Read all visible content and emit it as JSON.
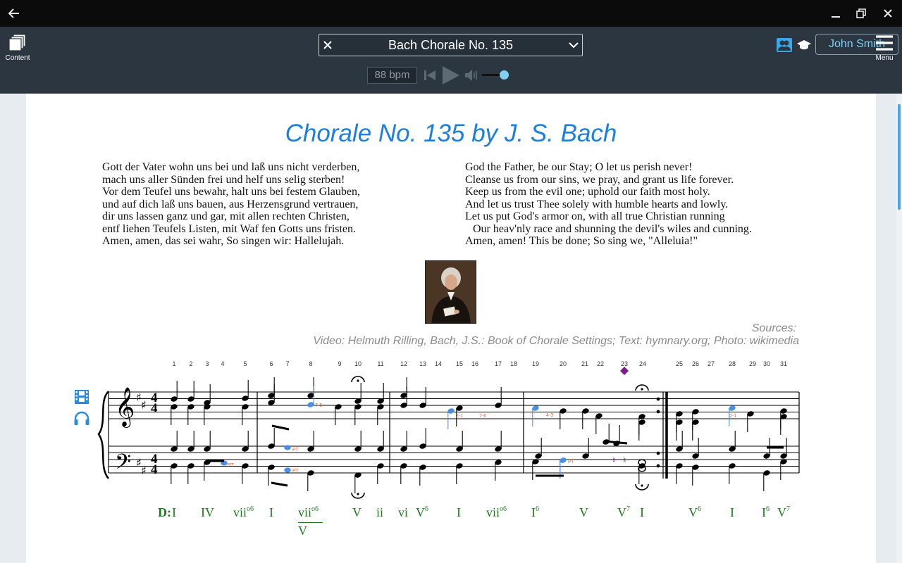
{
  "window": {
    "back_label": "←"
  },
  "toolbar": {
    "content_label": "Content",
    "menu_label": "Menu",
    "piece_selector": "Bach Chorale No. 135",
    "tempo": "88 bpm",
    "user_name": "John Smith"
  },
  "document": {
    "title": "Chorale No. 135 by J. S. Bach",
    "lyrics_german": [
      "Gott der Vater wohn uns bei und laß uns nicht verderben,",
      "mach uns aller Sünden frei und helf uns selig sterben!",
      "Vor dem Teufel uns bewahr, halt uns bei festem Glauben,",
      "und auf dich laß uns bauen, aus Herzensgrund vertrauen,",
      "dir uns lassen ganz und gar, mit allen rechten Christen,",
      "entf liehen Teufels Listen, mit Waf fen Gotts uns fristen.",
      "Amen, amen, das sei wahr, So singen wir: Hallelujah."
    ],
    "lyrics_english": [
      "God the Father, be our Stay; O let us perish never!",
      "Cleanse us from our sins, we pray, and grant us life forever.",
      "Keep us from the evil one; uphold our faith most holy.",
      "And let us trust Thee solely with humble hearts and lowly.",
      "Let us put God's armor on, with all true Christian running",
      "Our heav'nly race and shunning the devil's wiles and cunning.",
      "Amen, amen! This be done; So sing we, \"Alleluia!\""
    ],
    "sources_label": "Sources:",
    "sources_text": "Video: Helmuth Rilling, Bach, J.S.: Book of Chorale Settings; Text: hymnary.org; Photo: wikimedia"
  },
  "score": {
    "key_label": "D:",
    "beat_numbers": [
      "1",
      "2",
      "3",
      "4",
      "5",
      "6",
      "7",
      "8",
      "9",
      "10",
      "11",
      "12",
      "13",
      "14",
      "15",
      "16",
      "17",
      "18",
      "19",
      "20",
      "21",
      "22",
      "23",
      "24",
      "25",
      "26",
      "27",
      "28",
      "29",
      "30",
      "31"
    ],
    "roman_numerals": [
      {
        "base": "I",
        "sup": ""
      },
      {
        "base": "IV",
        "sup": ""
      },
      {
        "base": "vii",
        "sup": "o6"
      },
      {
        "base": "I",
        "sup": ""
      },
      {
        "base": "vii",
        "sup": "o6"
      },
      {
        "base": "V",
        "sup": ""
      },
      {
        "base": "ii",
        "sup": ""
      },
      {
        "base": "vi",
        "sup": ""
      },
      {
        "base": "V",
        "sup": "6"
      },
      {
        "base": "I",
        "sup": ""
      },
      {
        "base": "vii",
        "sup": "o6"
      },
      {
        "base": "I",
        "sup": "6"
      },
      {
        "base": "V",
        "sup": ""
      },
      {
        "base": "V",
        "sup": "7"
      },
      {
        "base": "I",
        "sup": ""
      },
      {
        "base": "V",
        "sup": "6"
      },
      {
        "base": "I",
        "sup": ""
      },
      {
        "base": "I",
        "sup": "6"
      },
      {
        "base": "V",
        "sup": "7"
      }
    ],
    "secondary_denominator": "V",
    "annotations": {
      "pt": "PT",
      "s76": "7-6",
      "s21": "2-1",
      "s43": "4-3"
    }
  }
}
